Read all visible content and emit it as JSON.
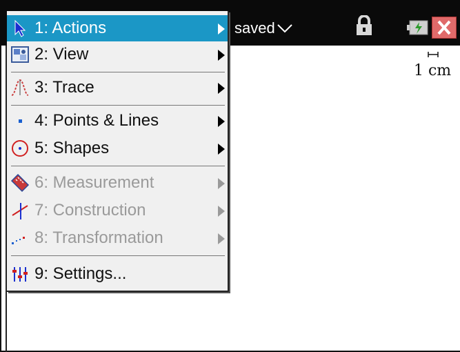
{
  "document": {
    "title": "saved"
  },
  "scale": {
    "label": "1 cm"
  },
  "menu": {
    "items": [
      {
        "label": "1: Actions",
        "state": "selected",
        "icon": "pointer-arrow-icon"
      },
      {
        "label": "2: View",
        "state": "enabled",
        "icon": "view-icon"
      },
      {
        "label": "3: Trace",
        "state": "enabled",
        "icon": "trace-icon"
      },
      {
        "label": "4: Points & Lines",
        "state": "enabled",
        "icon": "point-icon"
      },
      {
        "label": "5: Shapes",
        "state": "enabled",
        "icon": "circle-shape-icon"
      },
      {
        "label": "6: Measurement",
        "state": "disabled",
        "icon": "ruler-icon"
      },
      {
        "label": "7: Construction",
        "state": "disabled",
        "icon": "construction-icon"
      },
      {
        "label": "8: Transformation",
        "state": "disabled",
        "icon": "transformation-icon"
      },
      {
        "label": "9: Settings...",
        "state": "enabled",
        "icon": "settings-sliders-icon"
      }
    ]
  },
  "colors": {
    "selection": "#1b97c6",
    "titlebar": "#0a0a0a",
    "menu_background": "#f0f0f0",
    "disabled_text": "#9a9a9a"
  }
}
